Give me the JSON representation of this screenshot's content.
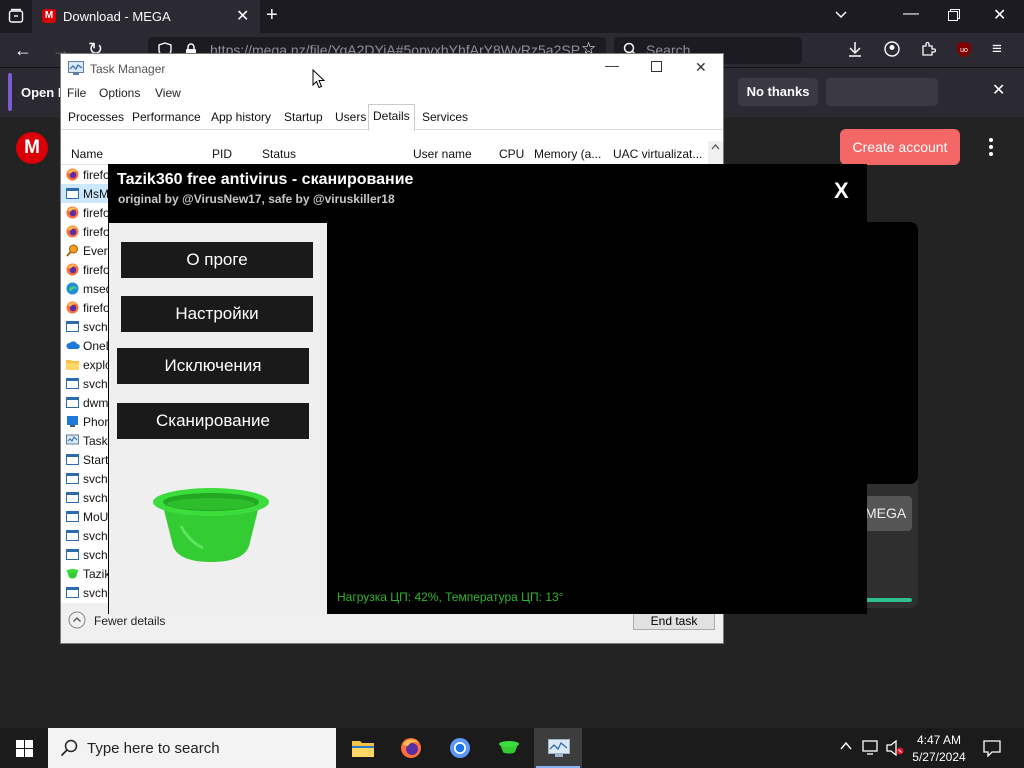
{
  "browser": {
    "tab_title": "Download - MEGA",
    "url": "https://mega.nz/file/YqA2DYiA#5opvxhYhfArY8WyRz5a2SP",
    "search_placeholder": "Search"
  },
  "notification": {
    "text": "Open F",
    "no_thanks_label": "No thanks"
  },
  "mega": {
    "create_account_label": "Create account",
    "download_button_label": "MEGA",
    "accent_color": "#f46767"
  },
  "task_manager": {
    "title": "Task Manager",
    "menu": [
      "File",
      "Options",
      "View"
    ],
    "tabs": [
      "Processes",
      "Performance",
      "App history",
      "Startup",
      "Users",
      "Details",
      "Services"
    ],
    "active_tab": "Details",
    "columns": [
      "Name",
      "PID",
      "Status",
      "User name",
      "CPU",
      "Memory (a...",
      "UAC virtualizat..."
    ],
    "rows": [
      {
        "name": "firefo",
        "icon": "firefox-icon"
      },
      {
        "name": "MsM",
        "icon": "window-icon",
        "selected": true
      },
      {
        "name": "firefo",
        "icon": "firefox-icon"
      },
      {
        "name": "firefo",
        "icon": "firefox-icon"
      },
      {
        "name": "Every",
        "icon": "magnifier-icon"
      },
      {
        "name": "firefo",
        "icon": "firefox-icon"
      },
      {
        "name": "msed",
        "icon": "edge-icon"
      },
      {
        "name": "firefo",
        "icon": "firefox-icon"
      },
      {
        "name": "svch",
        "icon": "window-icon"
      },
      {
        "name": "OneD",
        "icon": "cloud-icon"
      },
      {
        "name": "explo",
        "icon": "folder-icon"
      },
      {
        "name": "svch",
        "icon": "window-icon"
      },
      {
        "name": "dwm",
        "icon": "window-icon"
      },
      {
        "name": "Phor",
        "icon": "phone-icon"
      },
      {
        "name": "Taskr",
        "icon": "taskmgr-icon"
      },
      {
        "name": "Start",
        "icon": "window-icon"
      },
      {
        "name": "svch",
        "icon": "window-icon"
      },
      {
        "name": "svch",
        "icon": "window-icon"
      },
      {
        "name": "MoU",
        "icon": "window-icon"
      },
      {
        "name": "svch",
        "icon": "window-icon"
      },
      {
        "name": "svch",
        "icon": "window-icon"
      },
      {
        "name": "Tazik",
        "icon": "basin-icon"
      },
      {
        "name": "svch",
        "icon": "window-icon"
      }
    ],
    "fewer_details_label": "Fewer details",
    "end_task_label": "End task"
  },
  "tazik": {
    "title": "Tazik360 free antivirus - сканирование",
    "subtitle": "original by @VirusNew17, safe by @viruskiller18",
    "close_label": "X",
    "buttons": [
      "О проге",
      "Настройки",
      "Исключения",
      "Сканирование"
    ],
    "status": "Нагрузка ЦП: 42%, Температура ЦП: 13°",
    "basin_color": "#3ddc3d",
    "status_color": "#2fb72f"
  },
  "taskbar": {
    "search_placeholder": "Type here to search",
    "time": "4:47 AM",
    "date": "5/27/2024"
  }
}
